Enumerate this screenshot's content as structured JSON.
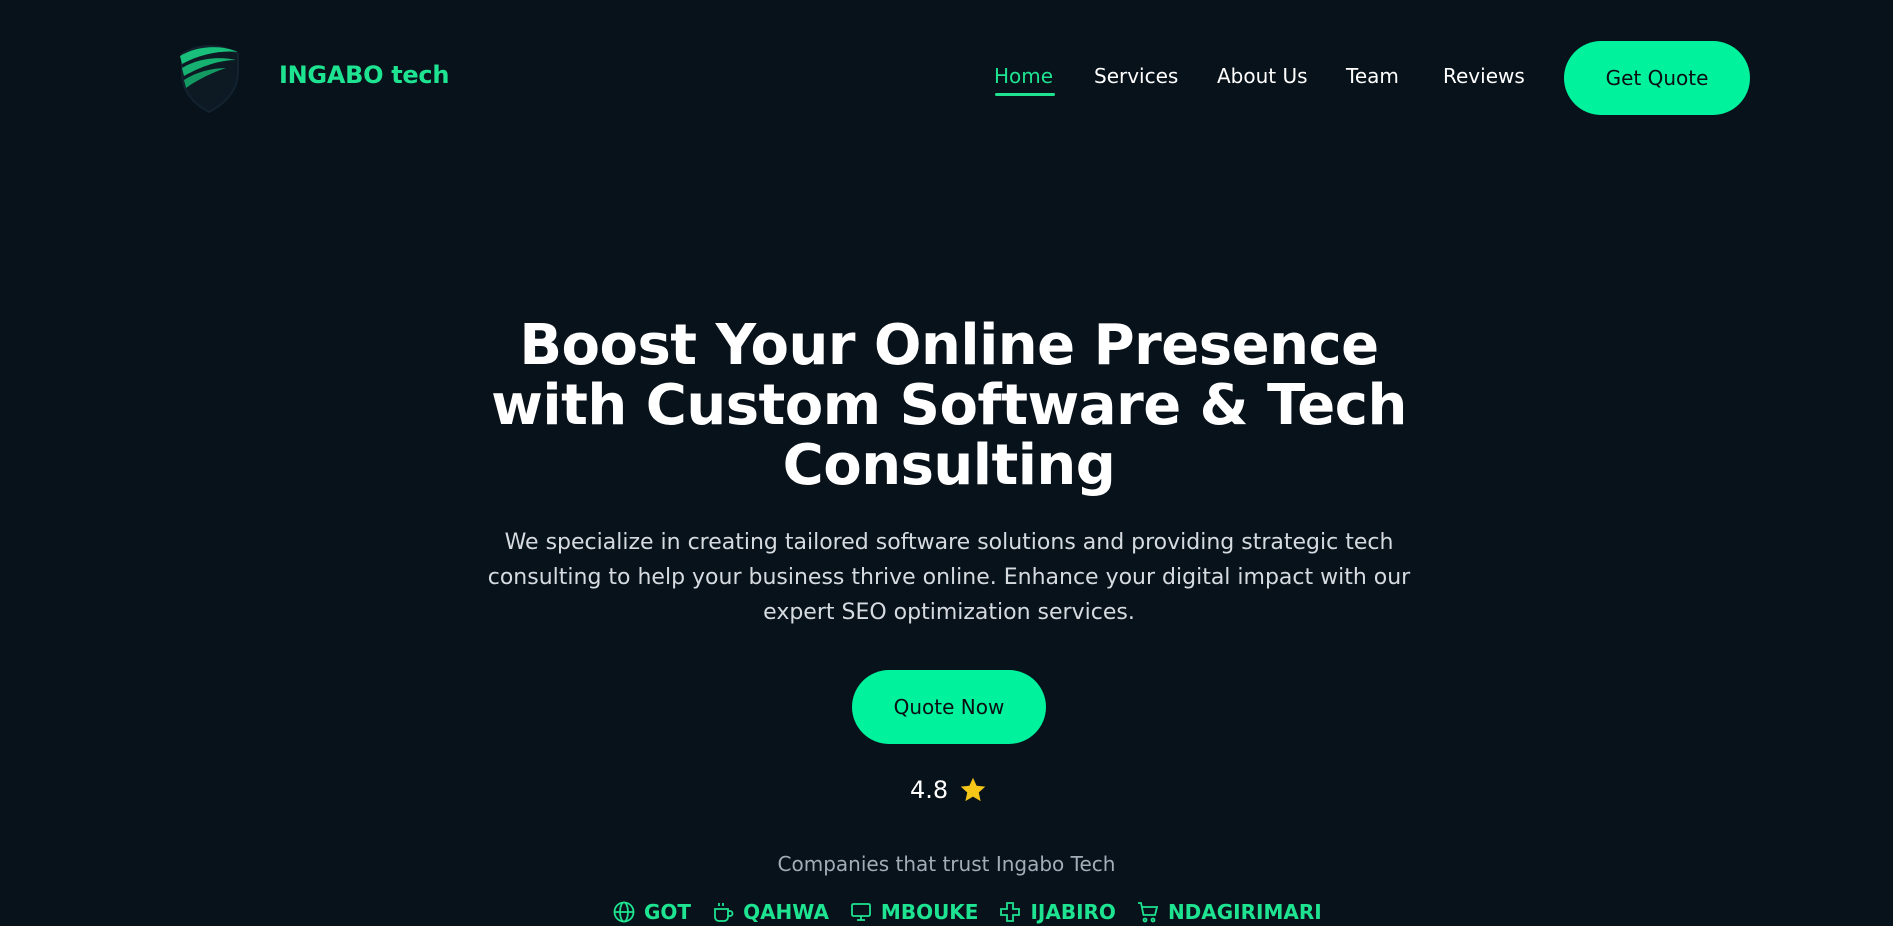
{
  "brand": {
    "name": "INGABO tech",
    "accent_color": "#1ee391"
  },
  "nav": {
    "items": [
      {
        "label": "Home",
        "active": true
      },
      {
        "label": "Services",
        "active": false
      },
      {
        "label": "About Us",
        "active": false
      },
      {
        "label": "Team",
        "active": false
      },
      {
        "label": "Reviews",
        "active": false
      }
    ],
    "cta_label": "Get Quote"
  },
  "hero": {
    "title_lines": [
      "Boost Your Online Presence",
      "with Custom Software & Tech",
      "Consulting"
    ],
    "subtitle_lines": [
      "We specialize in creating tailored software solutions and providing strategic tech",
      "consulting to help your business thrive online. Enhance your digital impact with our",
      "expert SEO optimization services."
    ],
    "cta_label": "Quote Now",
    "rating": "4.8",
    "rating_icon": "star-icon"
  },
  "trust": {
    "label": "Companies that trust Ingabo Tech",
    "companies": [
      {
        "name": "GOT",
        "icon": "globe-icon"
      },
      {
        "name": "QAHWA",
        "icon": "coffee-cup-icon"
      },
      {
        "name": "MBOUKE",
        "icon": "monitor-icon"
      },
      {
        "name": "IJABIRO",
        "icon": "plus-icon"
      },
      {
        "name": "NDAGIRIMARI",
        "icon": "shopping-cart-icon"
      }
    ]
  },
  "colors": {
    "background": "#08121b",
    "button": "#00f29c",
    "star": "#f5c518"
  }
}
